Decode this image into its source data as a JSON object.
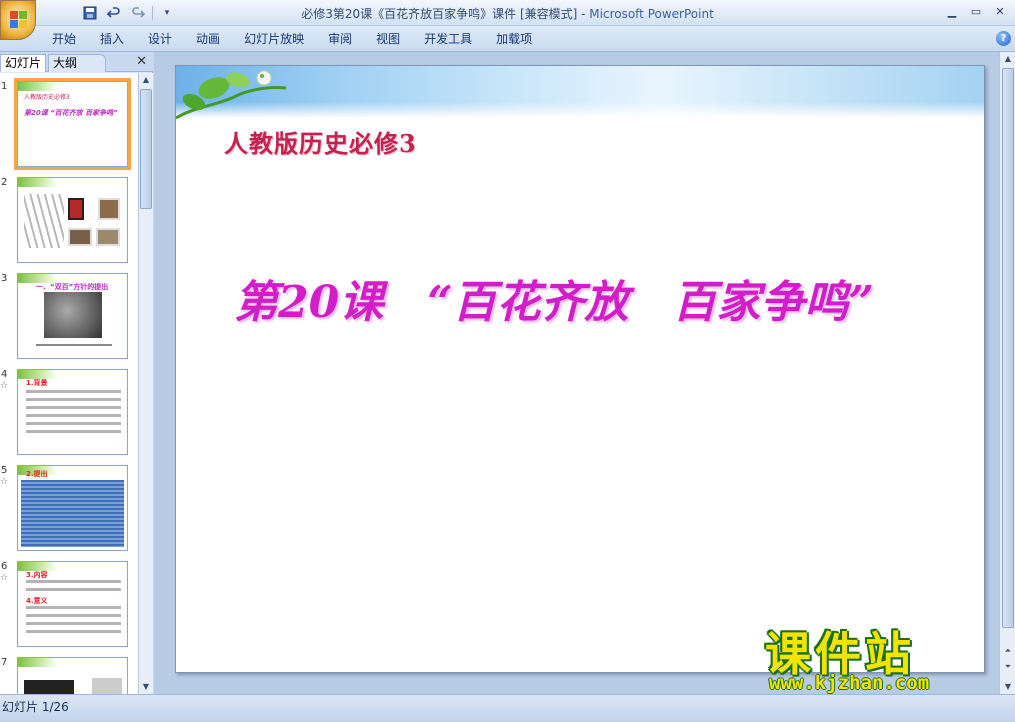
{
  "window": {
    "title_doc": "必修3第20课《百花齐放百家争鸣》课件 [兼容模式]",
    "title_sep": " - ",
    "title_app": "Microsoft PowerPoint"
  },
  "quick_access": {
    "save_icon": "save-icon",
    "undo_icon": "undo-icon",
    "redo_icon": "redo-icon"
  },
  "ribbon": {
    "tabs": [
      "开始",
      "插入",
      "设计",
      "动画",
      "幻灯片放映",
      "审阅",
      "视图",
      "开发工具",
      "加载项"
    ]
  },
  "left_pane": {
    "tab_slides": "幻灯片",
    "tab_outline": "大纲",
    "thumbnails": [
      {
        "num": "1",
        "star": ""
      },
      {
        "num": "2",
        "star": ""
      },
      {
        "num": "3",
        "star": ""
      },
      {
        "num": "4",
        "star": "☆"
      },
      {
        "num": "5",
        "star": "☆"
      },
      {
        "num": "6",
        "star": "☆"
      },
      {
        "num": "7",
        "star": ""
      }
    ],
    "thumb1": {
      "line1": "人教版历史必修3",
      "line2": "第20课 “百花齐放 百家争鸣”"
    },
    "thumb3": {
      "heading": "一、“双百”方针的提出"
    },
    "thumb4": {
      "heading": "1.背景"
    },
    "thumb5": {
      "heading": "2.提出"
    },
    "thumb6": {
      "heading_a": "3.内容",
      "heading_b": "4.意义"
    }
  },
  "slide": {
    "subtitle": "人教版历史必修3",
    "title": "第20课　“百花齐放　百家争鸣”"
  },
  "status": {
    "slide_counter": "幻灯片 1/26"
  },
  "watermark": {
    "brand": "课件站",
    "url": "www.kjzhan.com"
  },
  "colors": {
    "title_magenta": "#d11ec9",
    "subtitle_red": "#c3244f",
    "ribbon_blue": "#c9dbf1",
    "selected_thumb": "#f3a94b"
  }
}
